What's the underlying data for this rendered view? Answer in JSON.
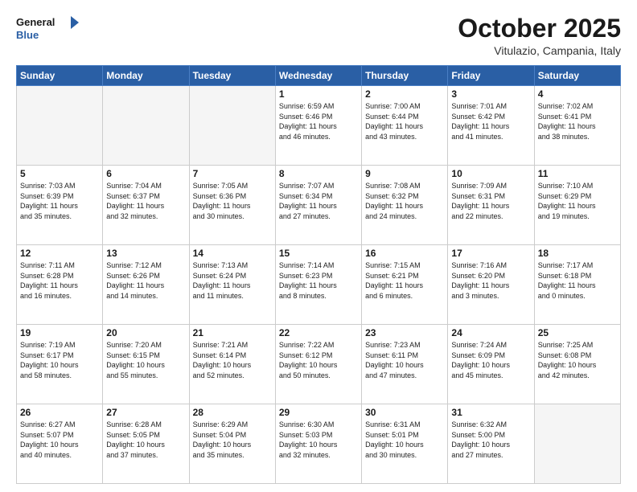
{
  "header": {
    "logo_line1": "General",
    "logo_line2": "Blue",
    "month": "October 2025",
    "location": "Vitulazio, Campania, Italy"
  },
  "weekdays": [
    "Sunday",
    "Monday",
    "Tuesday",
    "Wednesday",
    "Thursday",
    "Friday",
    "Saturday"
  ],
  "weeks": [
    [
      {
        "day": "",
        "info": ""
      },
      {
        "day": "",
        "info": ""
      },
      {
        "day": "",
        "info": ""
      },
      {
        "day": "1",
        "info": "Sunrise: 6:59 AM\nSunset: 6:46 PM\nDaylight: 11 hours\nand 46 minutes."
      },
      {
        "day": "2",
        "info": "Sunrise: 7:00 AM\nSunset: 6:44 PM\nDaylight: 11 hours\nand 43 minutes."
      },
      {
        "day": "3",
        "info": "Sunrise: 7:01 AM\nSunset: 6:42 PM\nDaylight: 11 hours\nand 41 minutes."
      },
      {
        "day": "4",
        "info": "Sunrise: 7:02 AM\nSunset: 6:41 PM\nDaylight: 11 hours\nand 38 minutes."
      }
    ],
    [
      {
        "day": "5",
        "info": "Sunrise: 7:03 AM\nSunset: 6:39 PM\nDaylight: 11 hours\nand 35 minutes."
      },
      {
        "day": "6",
        "info": "Sunrise: 7:04 AM\nSunset: 6:37 PM\nDaylight: 11 hours\nand 32 minutes."
      },
      {
        "day": "7",
        "info": "Sunrise: 7:05 AM\nSunset: 6:36 PM\nDaylight: 11 hours\nand 30 minutes."
      },
      {
        "day": "8",
        "info": "Sunrise: 7:07 AM\nSunset: 6:34 PM\nDaylight: 11 hours\nand 27 minutes."
      },
      {
        "day": "9",
        "info": "Sunrise: 7:08 AM\nSunset: 6:32 PM\nDaylight: 11 hours\nand 24 minutes."
      },
      {
        "day": "10",
        "info": "Sunrise: 7:09 AM\nSunset: 6:31 PM\nDaylight: 11 hours\nand 22 minutes."
      },
      {
        "day": "11",
        "info": "Sunrise: 7:10 AM\nSunset: 6:29 PM\nDaylight: 11 hours\nand 19 minutes."
      }
    ],
    [
      {
        "day": "12",
        "info": "Sunrise: 7:11 AM\nSunset: 6:28 PM\nDaylight: 11 hours\nand 16 minutes."
      },
      {
        "day": "13",
        "info": "Sunrise: 7:12 AM\nSunset: 6:26 PM\nDaylight: 11 hours\nand 14 minutes."
      },
      {
        "day": "14",
        "info": "Sunrise: 7:13 AM\nSunset: 6:24 PM\nDaylight: 11 hours\nand 11 minutes."
      },
      {
        "day": "15",
        "info": "Sunrise: 7:14 AM\nSunset: 6:23 PM\nDaylight: 11 hours\nand 8 minutes."
      },
      {
        "day": "16",
        "info": "Sunrise: 7:15 AM\nSunset: 6:21 PM\nDaylight: 11 hours\nand 6 minutes."
      },
      {
        "day": "17",
        "info": "Sunrise: 7:16 AM\nSunset: 6:20 PM\nDaylight: 11 hours\nand 3 minutes."
      },
      {
        "day": "18",
        "info": "Sunrise: 7:17 AM\nSunset: 6:18 PM\nDaylight: 11 hours\nand 0 minutes."
      }
    ],
    [
      {
        "day": "19",
        "info": "Sunrise: 7:19 AM\nSunset: 6:17 PM\nDaylight: 10 hours\nand 58 minutes."
      },
      {
        "day": "20",
        "info": "Sunrise: 7:20 AM\nSunset: 6:15 PM\nDaylight: 10 hours\nand 55 minutes."
      },
      {
        "day": "21",
        "info": "Sunrise: 7:21 AM\nSunset: 6:14 PM\nDaylight: 10 hours\nand 52 minutes."
      },
      {
        "day": "22",
        "info": "Sunrise: 7:22 AM\nSunset: 6:12 PM\nDaylight: 10 hours\nand 50 minutes."
      },
      {
        "day": "23",
        "info": "Sunrise: 7:23 AM\nSunset: 6:11 PM\nDaylight: 10 hours\nand 47 minutes."
      },
      {
        "day": "24",
        "info": "Sunrise: 7:24 AM\nSunset: 6:09 PM\nDaylight: 10 hours\nand 45 minutes."
      },
      {
        "day": "25",
        "info": "Sunrise: 7:25 AM\nSunset: 6:08 PM\nDaylight: 10 hours\nand 42 minutes."
      }
    ],
    [
      {
        "day": "26",
        "info": "Sunrise: 6:27 AM\nSunset: 5:07 PM\nDaylight: 10 hours\nand 40 minutes."
      },
      {
        "day": "27",
        "info": "Sunrise: 6:28 AM\nSunset: 5:05 PM\nDaylight: 10 hours\nand 37 minutes."
      },
      {
        "day": "28",
        "info": "Sunrise: 6:29 AM\nSunset: 5:04 PM\nDaylight: 10 hours\nand 35 minutes."
      },
      {
        "day": "29",
        "info": "Sunrise: 6:30 AM\nSunset: 5:03 PM\nDaylight: 10 hours\nand 32 minutes."
      },
      {
        "day": "30",
        "info": "Sunrise: 6:31 AM\nSunset: 5:01 PM\nDaylight: 10 hours\nand 30 minutes."
      },
      {
        "day": "31",
        "info": "Sunrise: 6:32 AM\nSunset: 5:00 PM\nDaylight: 10 hours\nand 27 minutes."
      },
      {
        "day": "",
        "info": ""
      }
    ]
  ]
}
